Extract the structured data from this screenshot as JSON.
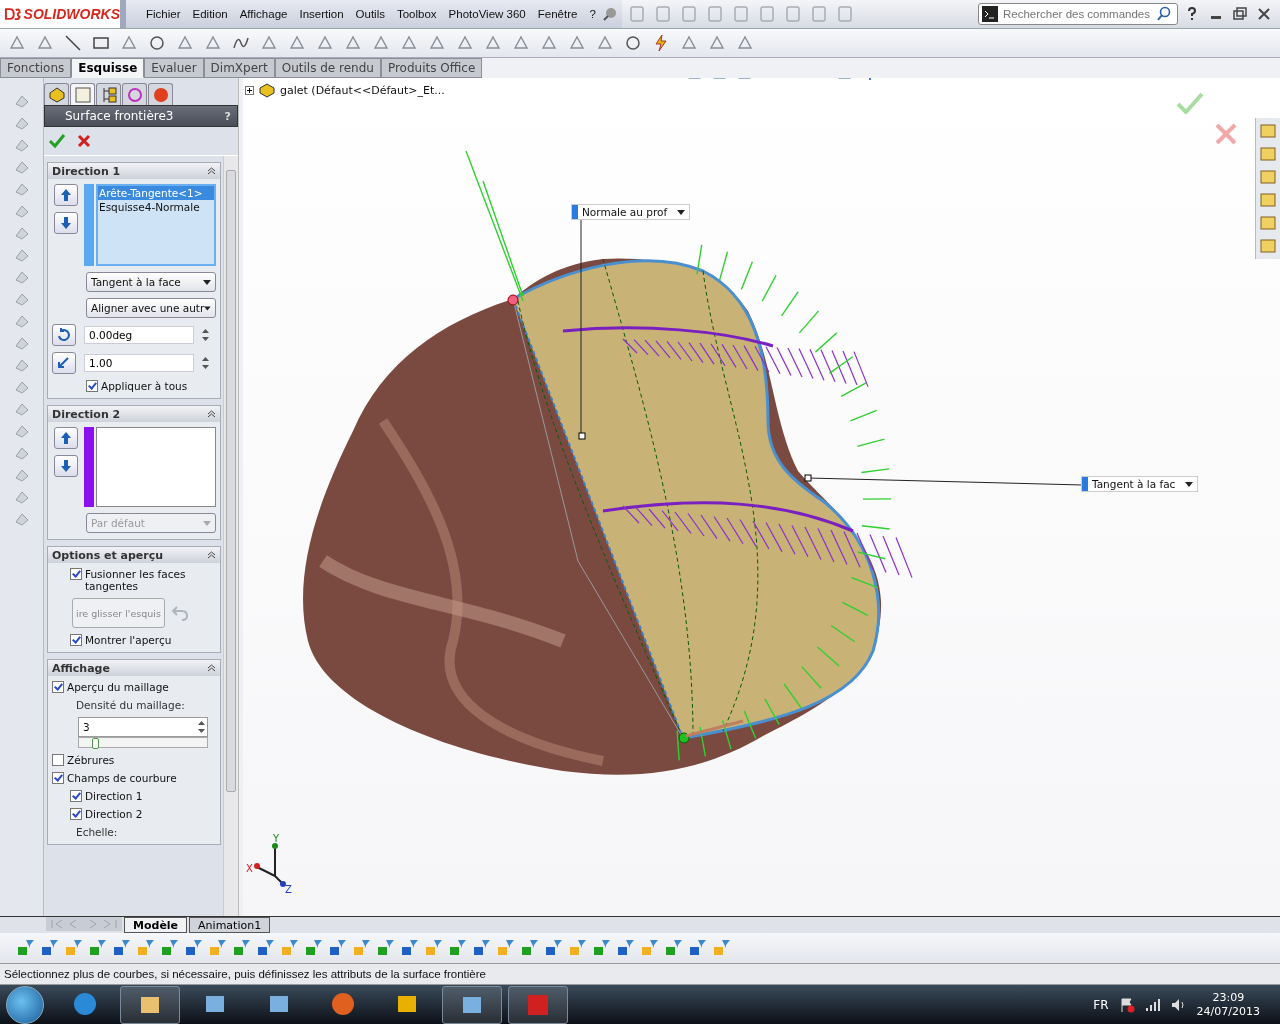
{
  "app": {
    "name": "SOLIDWORKS"
  },
  "menu": [
    "Fichier",
    "Edition",
    "Affichage",
    "Insertion",
    "Outils",
    "Toolbox",
    "PhotoView 360",
    "Fenêtre",
    "?"
  ],
  "search": {
    "placeholder": "Rechercher des commandes"
  },
  "command_tabs": [
    {
      "label": "Fonctions",
      "selected": false
    },
    {
      "label": "Esquisse",
      "selected": true
    },
    {
      "label": "Evaluer",
      "selected": false
    },
    {
      "label": "DimXpert",
      "selected": false
    },
    {
      "label": "Outils de rendu",
      "selected": false
    },
    {
      "label": "Produits Office",
      "selected": false
    }
  ],
  "panel_tabs": [
    {
      "selected": false
    },
    {
      "selected": true
    },
    {
      "selected": false
    },
    {
      "selected": false
    },
    {
      "selected": false
    }
  ],
  "feature": {
    "title": "Surface frontière3",
    "help": "?"
  },
  "direction1": {
    "title": "Direction 1",
    "items": [
      {
        "label": "Arête-Tangente<1>",
        "selected": true
      },
      {
        "label": "Esquisse4-Normale",
        "selected": false
      }
    ],
    "tangency": "Tangent à la face",
    "alignment": "Aligner avec une autr",
    "angle": "0.00deg",
    "length": "1.00",
    "apply_all": {
      "label": "Appliquer à tous",
      "checked": true
    }
  },
  "direction2": {
    "title": "Direction 2",
    "dropdown": {
      "value": "Par défaut",
      "disabled": true
    }
  },
  "options": {
    "title": "Options et aperçu",
    "merge": {
      "label": "Fusionner les faces tangentes",
      "checked": true
    },
    "drag_button": {
      "label": "ire glisser l'esquis",
      "disabled": true
    },
    "preview": {
      "label": "Montrer l'aperçu",
      "checked": true
    }
  },
  "display": {
    "title": "Affichage",
    "mesh_preview": {
      "label": "Aperçu du maillage",
      "checked": true
    },
    "density_label": "Densité du maillage:",
    "density": "3",
    "density_slider": {
      "level": 0.1
    },
    "items": [
      {
        "label": "Zébrures",
        "checked": false
      },
      {
        "label": "Champs de courbure",
        "checked": true,
        "children": [
          {
            "label": "Direction 1",
            "checked": true
          },
          {
            "label": "Direction 2",
            "checked": true
          }
        ]
      }
    ],
    "scale_label": "Echelle:"
  },
  "model_tree": {
    "label": "galet  (Défaut<<Défaut>_Et..."
  },
  "callouts": [
    {
      "label": "Normale au prof"
    },
    {
      "label": "Tangent à la fac"
    }
  ],
  "axes": [
    "Y",
    "X",
    "Z"
  ],
  "bottom_tabs": [
    {
      "label": "Modèle",
      "selected": true
    },
    {
      "label": "Animation1",
      "selected": false
    }
  ],
  "status_bar": {
    "message": "Sélectionnez plus de courbes, si nécessaire, puis définissez les attributs de la surface frontière"
  },
  "taskbar": {
    "language": "FR",
    "time": "23:09",
    "date": "24/07/2013"
  }
}
